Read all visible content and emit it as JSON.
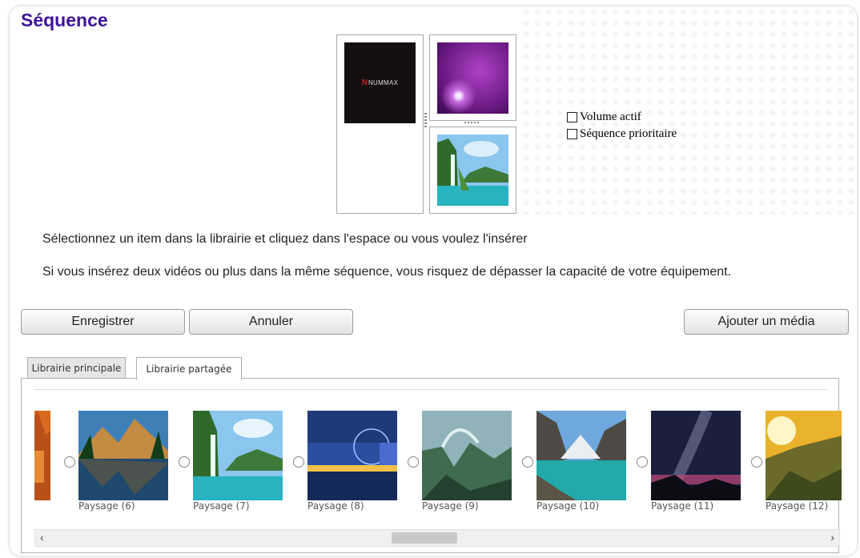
{
  "page": {
    "title": "Séquence"
  },
  "layout_preview": {
    "logo_text": "NUMMAX"
  },
  "options": {
    "volume_label": "Volume actif",
    "priority_label": "Séquence prioritaire"
  },
  "messages": {
    "line1": "Sélectionnez un item dans la librairie et cliquez dans l'espace ou vous voulez l'insérer",
    "line2": "Si vous insérez deux vidéos ou plus dans la même séquence, vous risquez de dépasser la capacité de votre équipement."
  },
  "buttons": {
    "save": "Enregistrer",
    "cancel": "Annuler",
    "add_media": "Ajouter un média"
  },
  "tabs": [
    {
      "label": "Librairie principale"
    },
    {
      "label": "Librairie partagée"
    }
  ],
  "library": {
    "items": [
      {
        "caption": "Paysage (6)"
      },
      {
        "caption": "Paysage (7)"
      },
      {
        "caption": "Paysage (8)"
      },
      {
        "caption": "Paysage (9)"
      },
      {
        "caption": "Paysage (10)"
      },
      {
        "caption": "Paysage (11)"
      },
      {
        "caption": "Paysage (12)"
      }
    ]
  },
  "scroll": {
    "left_arrow": "‹",
    "right_arrow": "›"
  }
}
